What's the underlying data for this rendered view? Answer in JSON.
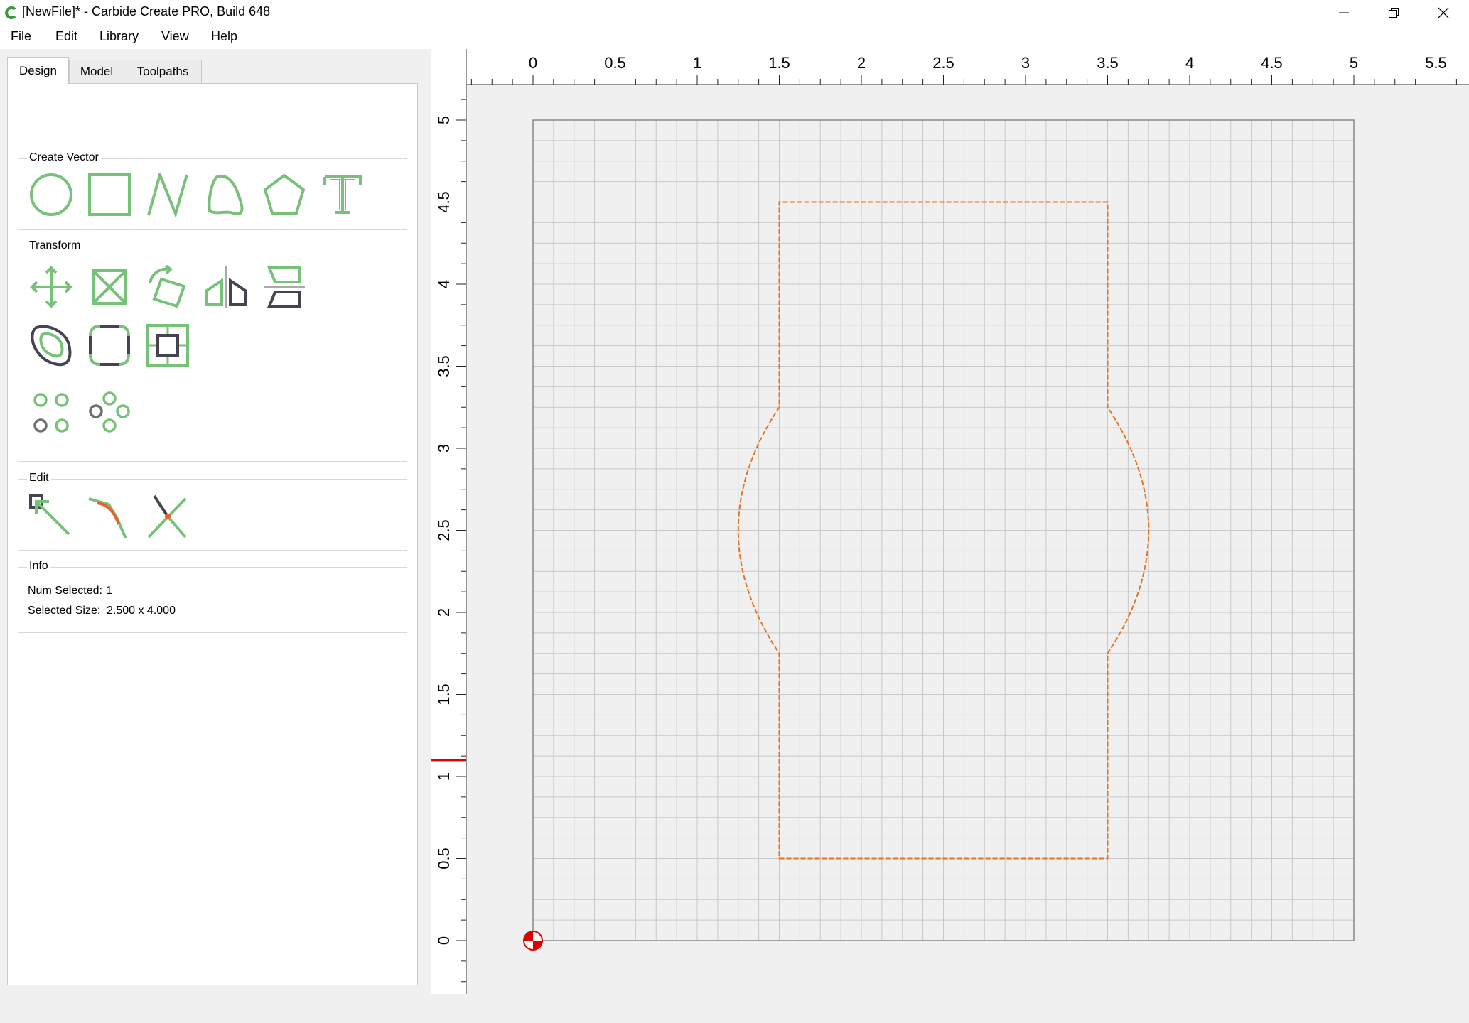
{
  "window": {
    "title": "[NewFile]* - Carbide Create PRO, Build 648",
    "app_icon": "carbide-c-logo",
    "controls": [
      "minimize-icon",
      "restore-icon",
      "close-icon"
    ]
  },
  "menu": {
    "items": [
      "File",
      "Edit",
      "Library",
      "View",
      "Help"
    ]
  },
  "tabs": [
    {
      "label": "Design",
      "active": true
    },
    {
      "label": "Model",
      "active": false
    },
    {
      "label": "Toolpaths",
      "active": false
    }
  ],
  "design": {
    "create_vector": {
      "title": "Create Vector",
      "tools": [
        "circle-icon",
        "rectangle-icon",
        "polyline-icon",
        "curve-icon",
        "polygon-icon",
        "text-icon"
      ]
    },
    "transform": {
      "title": "Transform",
      "tools": [
        "move-icon",
        "scale-icon",
        "rotate-icon",
        "mirror-icon",
        "flip-icon",
        "offset-icon",
        "fillet-icon",
        "align-icon",
        "array-icon",
        "circular-array-icon"
      ]
    },
    "edit": {
      "title": "Edit",
      "tools": [
        "node-edit-icon",
        "join-curves-icon",
        "trim-icon"
      ]
    },
    "info": {
      "title": "Info",
      "num_selected_label": "Num Selected:",
      "num_selected_value": "1",
      "size_label": "Selected Size:",
      "size_value": "2.500 x 4.000"
    }
  },
  "canvas": {
    "x_ruler_labels": [
      "0",
      "0.5",
      "1",
      "1.5",
      "2",
      "2.5",
      "3",
      "3.5",
      "4",
      "4.5",
      "5",
      "5.5"
    ],
    "y_ruler_labels": [
      "0",
      "0.5",
      "1",
      "1.5",
      "2",
      "2.5",
      "3",
      "3.5",
      "4",
      "4.5",
      "5"
    ],
    "stock_width": 5,
    "stock_height": 5,
    "grid_spacing": 0.125,
    "cursor_y": 1.1,
    "colors": {
      "shape": "#e8711e",
      "grid": "#c8c8c8",
      "origin": "#e00000",
      "icon_green": "#78c178",
      "icon_dark": "#454551"
    },
    "shape": {
      "left": 1.5,
      "right": 3.5,
      "bottom": 0.5,
      "top": 4.5,
      "arc_start_y": 1.75,
      "arc_end_y": 3.25,
      "bulge_left": 1.25,
      "bulge_right": 3.75
    }
  }
}
